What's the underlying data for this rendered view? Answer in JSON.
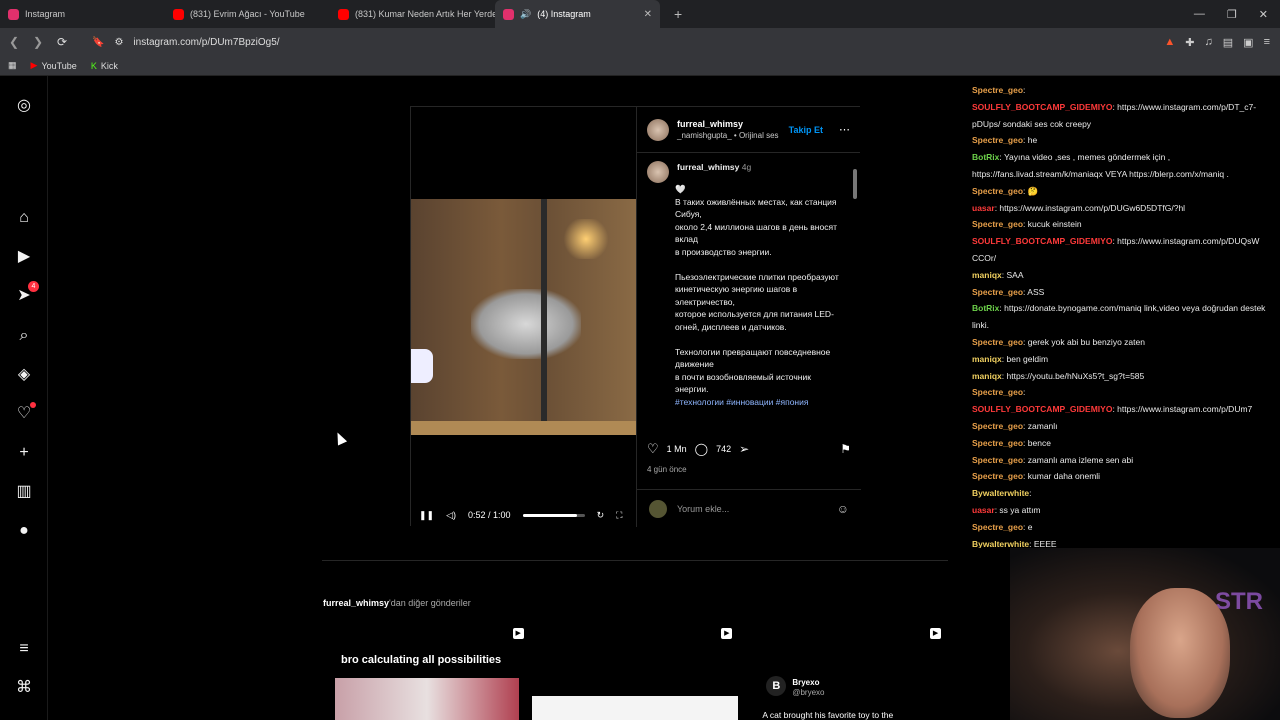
{
  "browser": {
    "tabs": [
      {
        "label": "Instagram",
        "fav": "#e1306c"
      },
      {
        "label": "(831) Evrim Ağacı - YouTube",
        "fav": "#ff0000"
      },
      {
        "label": "(831) Kumar Neden Artık Her Yerde?",
        "fav": "#ff0000"
      },
      {
        "label": "(4) Instagram",
        "fav": "#e1306c"
      }
    ],
    "url": "instagram.com/p/DUm7BpziOg5/",
    "bookmarks": [
      {
        "label": "YouTube",
        "color": "#ff0000"
      },
      {
        "label": "Kick",
        "color": "#53fc18"
      }
    ]
  },
  "post": {
    "username": "furreal_whimsy",
    "sub": "_namishgupta_ • Orijinal ses",
    "follow": "Takip Et",
    "caption_user": "furreal_whimsy",
    "caption_age": "4g",
    "caption_lines": "🤍\nВ таких оживлённых местах, как станция Сибуя,\nоколо 2,4 миллиона шагов в день вносят вклад\nв производство энергии.\n\nПьезоэлектрические плитки преобразуют\nкинетическую энергию шагов в электричество,\nкоторое используется для питания LED-огней, дисплеев и датчиков.\n\nТехнологии превращают повседневное движение\nв почти возобновляемый источник энергии.",
    "tags": "#технологии #инновации #япония",
    "likes": "1 Mn",
    "comments": "742",
    "ago": "4 gün önce",
    "comment_placeholder": "Yorum ekle...",
    "video_time": "0:52 / 1:00",
    "video_progress": 0.87
  },
  "more": {
    "user": "furreal_whimsy",
    "suffix": "'dan diğer gönderiler",
    "cards": [
      {
        "text": "bro calculating all possibilities",
        "bg": "#000"
      },
      {
        "text": "",
        "bg": "#000"
      },
      {
        "text": "A cat brought his favorite toy to the",
        "author": "Bryexo",
        "handle": "@bryexo",
        "bg": "#000"
      }
    ]
  },
  "chat": [
    {
      "u": "Spectre_geo",
      "c": "#e8a04a",
      "m": ""
    },
    {
      "u": "SOULFLY_BOOTCAMP_GIDEMIYO",
      "c": "#ff3a3a",
      "m": "https://www.instagram.com/p/DT_c7-pDUps/ sondaki ses cok creepy"
    },
    {
      "u": "Spectre_geo",
      "c": "#e8a04a",
      "m": "he"
    },
    {
      "u": "BotRix",
      "c": "#6cd04a",
      "m": "Yayına video ,ses , memes göndermek için , https://fans.livad.stream/k/maniaqx VEYA https://blerp.com/x/maniq ."
    },
    {
      "u": "Spectre_geo",
      "c": "#e8a04a",
      "m": "🤔"
    },
    {
      "u": "uasar",
      "c": "#ff3a3a",
      "m": "https://www.instagram.com/p/DUGw6D5DTfG/?hl"
    },
    {
      "u": "Spectre_geo",
      "c": "#e8a04a",
      "m": "kucuk einstein"
    },
    {
      "u": "SOULFLY_BOOTCAMP_GIDEMIYO",
      "c": "#ff3a3a",
      "m": "https://www.instagram.com/p/DUQsW CCOr/"
    },
    {
      "u": "maniqx",
      "c": "#f0d060",
      "m": "SAA"
    },
    {
      "u": "Spectre_geo",
      "c": "#e8a04a",
      "m": "ASS"
    },
    {
      "u": "BotRix",
      "c": "#6cd04a",
      "m": "https://donate.bynogame.com/maniq link,video veya doğrudan destek linki."
    },
    {
      "u": "Spectre_geo",
      "c": "#e8a04a",
      "m": "gerek yok abi bu benziyo zaten"
    },
    {
      "u": "maniqx",
      "c": "#f0d060",
      "m": "ben geldim"
    },
    {
      "u": "maniqx",
      "c": "#f0d060",
      "m": "https://youtu.be/hNuXs5?t_sg?t=585"
    },
    {
      "u": "Spectre_geo",
      "c": "#e8a04a",
      "m": ""
    },
    {
      "u": "SOULFLY_BOOTCAMP_GIDEMIYO",
      "c": "#ff3a3a",
      "m": "https://www.instagram.com/p/DUm7"
    },
    {
      "u": "Spectre_geo",
      "c": "#e8a04a",
      "m": "zamanlı"
    },
    {
      "u": "Spectre_geo",
      "c": "#e8a04a",
      "m": "bence"
    },
    {
      "u": "Spectre_geo",
      "c": "#e8a04a",
      "m": "zamanlı ama izleme sen abi"
    },
    {
      "u": "Spectre_geo",
      "c": "#e8a04a",
      "m": "kumar daha onemli"
    },
    {
      "u": "Bywalterwhite",
      "c": "#f0d060",
      "m": ""
    },
    {
      "u": "uasar",
      "c": "#ff3a3a",
      "m": "ss ya attım"
    },
    {
      "u": "Spectre_geo",
      "c": "#e8a04a",
      "m": "e"
    },
    {
      "u": "Bywalterwhite",
      "c": "#f0d060",
      "m": "EEEE"
    }
  ],
  "icons": [
    "instagram-icon",
    "home-icon",
    "reels-icon",
    "messages-icon",
    "search-icon",
    "explore-icon",
    "notifications-icon",
    "create-icon",
    "dashboard-icon",
    "profile-icon",
    "menu-icon",
    "apps-icon"
  ],
  "nav_badge": "4"
}
